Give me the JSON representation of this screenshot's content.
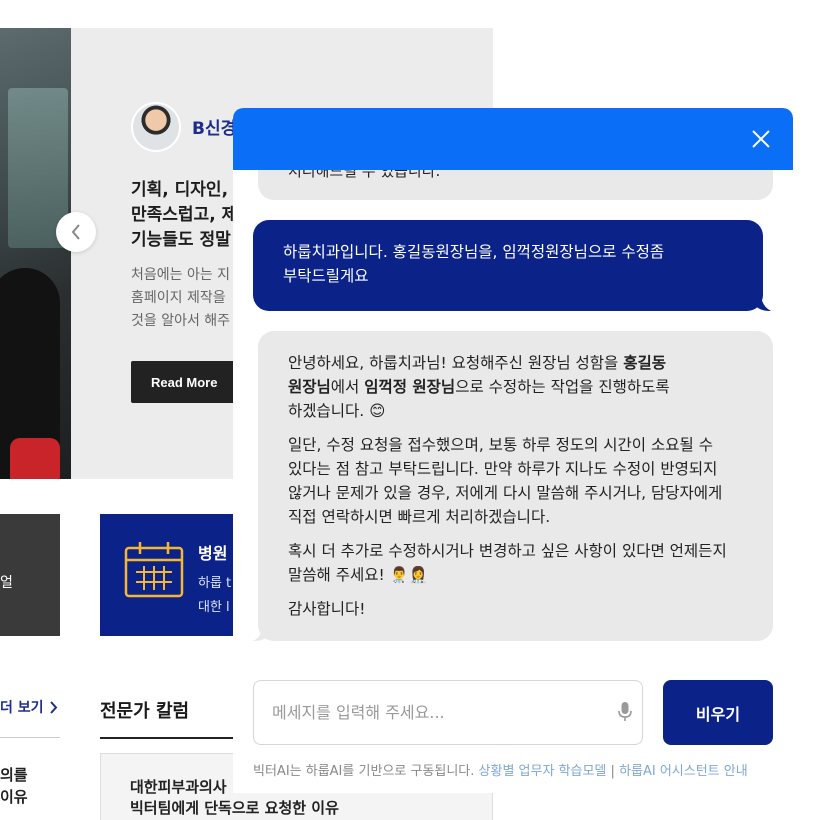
{
  "background": {
    "reviewer_name": "B신경",
    "review_heading": [
      "기획, 디자인,",
      "만족스럽고, 제",
      "기능들도 정말"
    ],
    "review_body": [
      "처음에는 아는 지",
      "홈페이지 제작을",
      "것을 알아서 해주"
    ],
    "read_more": "Read More",
    "dark_tile_text": "얼",
    "blue_tile": {
      "title": "병원",
      "sub1": "하룹 t",
      "sub2": "대한 l"
    },
    "see_more": "더 보기",
    "left_list": [
      "의를",
      "이유"
    ],
    "column": {
      "title": "전문가 칼럼",
      "line1": "대한피부과의사",
      "line2": "빅터팀에게 단독으로 요청한 이유"
    }
  },
  "chat": {
    "partial_bot_text": "처리해드릴 수 있습니다.",
    "user_message": [
      "하룹치과입니다. 홍길동원장님을, 임꺽정원장님으로 수정좀",
      "부탁드릴게요"
    ],
    "bot_reply": {
      "p1_a": "안녕하세요, 하룹치과님! 요청해주신 원장님 성함을 ",
      "p1_b1": "홍길동",
      "p1_b2": "원장님",
      "p1_c": "에서 ",
      "p1_b3": "임꺽정 원장님",
      "p1_d": "으로 수정하는 작업을 진행하도록",
      "p1_e": "하겠습니다. 😊",
      "p2": [
        "일단, 수정 요청을 접수했으며, 보통 하루 정도의 시간이 소요될 수",
        "있다는 점 참고 부탁드립니다. 만약 하루가 지나도 수정이 반영되지",
        "않거나 문제가 있을 경우, 저에게 다시 말씀해 주시거나, 담당자에게",
        "직접 연락하시면 빠르게 처리하겠습니다."
      ],
      "p3": [
        "혹시 더 추가로 수정하시거나 변경하고 싶은 사항이 있다면 언제든지",
        "말씀해 주세요! 👨‍⚕️👩‍⚕️"
      ],
      "p4": "감사합니다!"
    },
    "input_placeholder": "메세지를 입력해 주세요...",
    "clear_button": "비우기",
    "footer": {
      "text": "빅터AI는 하룹AI를 기반으로 구동됩니다. ",
      "link1": "상황별 업무자 학습모델",
      "sep": " | ",
      "link2": "하룹AI 어시스턴트 안내"
    },
    "colors": {
      "header": "#0b6ef7",
      "user_bubble": "#0b2388",
      "bot_bubble": "#e9e9e9"
    }
  }
}
